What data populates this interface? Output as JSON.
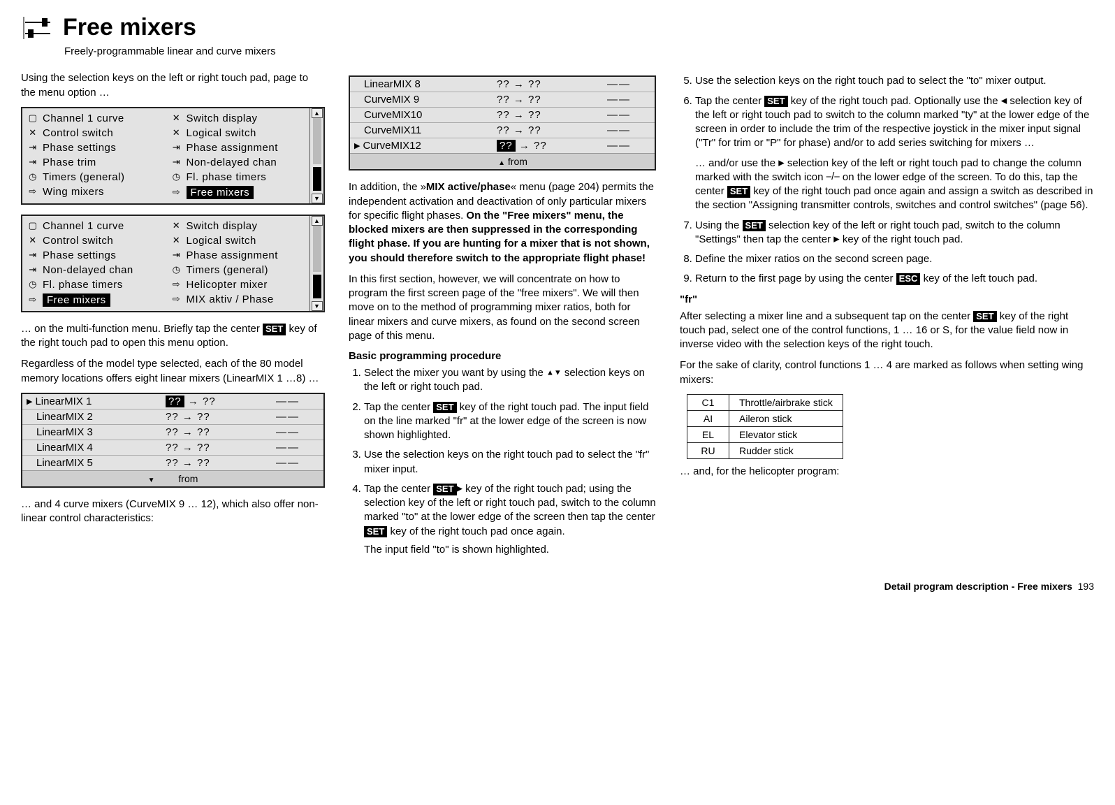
{
  "header": {
    "title": "Free mixers",
    "subtitle": "Freely-programmable linear and curve mixers"
  },
  "col_left": {
    "intro": "Using the selection keys on the left or right touch pad, page to the menu option …",
    "menu1": {
      "left": [
        {
          "icon": "▢",
          "label": "Channel 1 curve"
        },
        {
          "icon": "✕",
          "label": "Control switch"
        },
        {
          "icon": "⇥",
          "label": "Phase settings"
        },
        {
          "icon": "⇥",
          "label": "Phase trim"
        },
        {
          "icon": "◷",
          "label": "Timers (general)"
        },
        {
          "icon": "⇨",
          "label": "Wing mixers"
        }
      ],
      "right": [
        {
          "icon": "✕",
          "label": "Switch display"
        },
        {
          "icon": "✕",
          "label": "Logical switch"
        },
        {
          "icon": "⇥",
          "label": "Phase assignment"
        },
        {
          "icon": "⇥",
          "label": "Non-delayed chan"
        },
        {
          "icon": "◷",
          "label": "Fl. phase timers"
        },
        {
          "icon": "⇨",
          "label": "Free mixers",
          "highlight": true
        }
      ]
    },
    "menu2": {
      "left": [
        {
          "icon": "▢",
          "label": "Channel 1 curve"
        },
        {
          "icon": "✕",
          "label": "Control switch"
        },
        {
          "icon": "⇥",
          "label": "Phase settings"
        },
        {
          "icon": "⇥",
          "label": "Non-delayed chan"
        },
        {
          "icon": "◷",
          "label": "Fl. phase timers"
        },
        {
          "icon": "⇨",
          "label": "Free mixers",
          "highlight": true
        }
      ],
      "right": [
        {
          "icon": "✕",
          "label": "Switch display"
        },
        {
          "icon": "✕",
          "label": "Logical switch"
        },
        {
          "icon": "⇥",
          "label": "Phase assignment"
        },
        {
          "icon": "◷",
          "label": "Timers (general)"
        },
        {
          "icon": "⇨",
          "label": "Helicopter mixer"
        },
        {
          "icon": "⇨",
          "label": "MIX aktiv / Phase"
        }
      ]
    },
    "after_menus_1": "… on the multi-function menu. Briefly tap the center ",
    "set1": "SET",
    "after_menus_2": " key of the right touch pad to open this menu option.",
    "para2": "Regardless of the model type selected, each of the 80 model memory locations offers eight linear mixers (LinearMIX 1 …8) …",
    "linear_list": [
      {
        "name": "LinearMIX  1",
        "map": "?? → ??",
        "sel": true
      },
      {
        "name": "LinearMIX  2",
        "map": "?? → ??"
      },
      {
        "name": "LinearMIX  3",
        "map": "?? → ??"
      },
      {
        "name": "LinearMIX  4",
        "map": "?? → ??"
      },
      {
        "name": "LinearMIX  5",
        "map": "?? → ??"
      }
    ],
    "linear_footer": "from",
    "after_linear": "… and 4 curve mixers (CurveMIX 9 … 12), which also offer non-linear control characteristics:"
  },
  "col_mid": {
    "curve_list": [
      {
        "name": "LinearMIX   8",
        "map": "?? → ??"
      },
      {
        "name": "CurveMIX  9",
        "map": "?? → ??"
      },
      {
        "name": "CurveMIX10",
        "map": "?? → ??"
      },
      {
        "name": "CurveMIX11",
        "map": "?? → ??"
      },
      {
        "name": "CurveMIX12",
        "map": "?? → ??",
        "sel": true
      }
    ],
    "curve_footer": "from",
    "para1a": "In addition, the »",
    "para1_bold": "MIX active/phase",
    "para1b": "« menu (page 204) permits the independent activation and deactivation of only particular mixers for specific flight phases. ",
    "bold_block": "On the \"Free mixers\" menu, the blocked mixers are then suppressed in the corresponding flight phase. If you are hunting for a mixer that is not shown, you should therefore switch to the appropriate flight phase!",
    "para2": "In this first section, however, we will concentrate on how to program the first screen page of the \"free mixers\". We will then move on to the method of programming mixer ratios, both for linear mixers and curve mixers, as found on the second screen page of this menu.",
    "proc_head": "Basic programming procedure",
    "steps": [
      {
        "pre": "Select the mixer you want by using the ",
        "sym": "▲▼",
        "post": " selection keys on the left or right touch pad."
      },
      {
        "pre": "Tap the center ",
        "set": "SET",
        "post": " key of the right touch pad. The input field on the line marked \"fr\" at the lower edge of the screen is now shown highlighted."
      },
      {
        "pre": "Use the selection keys on the right touch pad to select the \"fr\" mixer input."
      },
      {
        "pre": "Tap the center ",
        "set": "SET",
        "mid": " key of the right touch pad; using the ",
        "sym": "▶",
        "mid2": " selection key of the left or right touch pad, switch to the column marked \"to\" at the lower edge of the screen then tap the center ",
        "set2": "SET",
        "post": " key of the right touch pad once again.",
        "extra": "The input field \"to\" is shown highlighted."
      }
    ]
  },
  "col_right": {
    "steps": [
      {
        "n": "5.",
        "text": "Use the selection keys on the right touch pad to select the \"to\" mixer output."
      },
      {
        "n": "6.",
        "pre": "Tap the center ",
        "set": "SET",
        "mid": " key of the right touch pad. Optionally use the ",
        "sym": "◀",
        "mid2": " selection key of the left or right touch pad to switch to the column marked \"ty\" at the lower edge of the screen in order to include the trim of the respective joystick in the mixer input signal (\"Tr\" for trim or \"P\" for phase) and/or to add series switching for mixers …",
        "cont1": "… and/or use the ",
        "sym2": "▶",
        "cont2": " selection key of the left or right touch pad to change the column marked with the switch icon ",
        "sw": "⎯/⎯",
        "cont3": " on the lower edge of the screen. To do this, tap the center ",
        "set2": "SET",
        "cont4": " key of the right touch pad once again and assign a switch as described in the section \"Assigning transmitter controls, switches and control switches\" (page 56)."
      },
      {
        "n": "7.",
        "pre": "Using the ",
        "sym": "▶",
        "mid": " selection key of the left or right touch pad, switch to the column \"Settings\" then tap the center ",
        "set": "SET",
        "post": " key of the right touch pad."
      },
      {
        "n": "8.",
        "text": "Define the mixer ratios on the second screen page."
      },
      {
        "n": "9.",
        "pre": "Return to the first page by using the center ",
        "set": "ESC",
        "post": " key of the left touch pad."
      }
    ],
    "fr_head": "\"fr\"",
    "fr_para_pre": "After selecting a mixer line and a subsequent tap on the center ",
    "fr_set": "SET",
    "fr_para_post": " key of the right touch pad, select one of the control functions, 1 … 16 or S, for the value field now in inverse video with the selection keys of the right touch.",
    "fr_para2": "For the sake of clarity, control functions 1 … 4 are marked as follows when setting wing mixers:",
    "sticks": [
      {
        "code": "C1",
        "label": "Throttle/airbrake stick"
      },
      {
        "code": "AI",
        "label": "Aileron stick"
      },
      {
        "code": "EL",
        "label": "Elevator stick"
      },
      {
        "code": "RU",
        "label": "Rudder stick"
      }
    ],
    "heli_note": "… and, for the helicopter program:"
  },
  "footer": {
    "label": "Detail program description - Free mixers",
    "page": "193"
  }
}
